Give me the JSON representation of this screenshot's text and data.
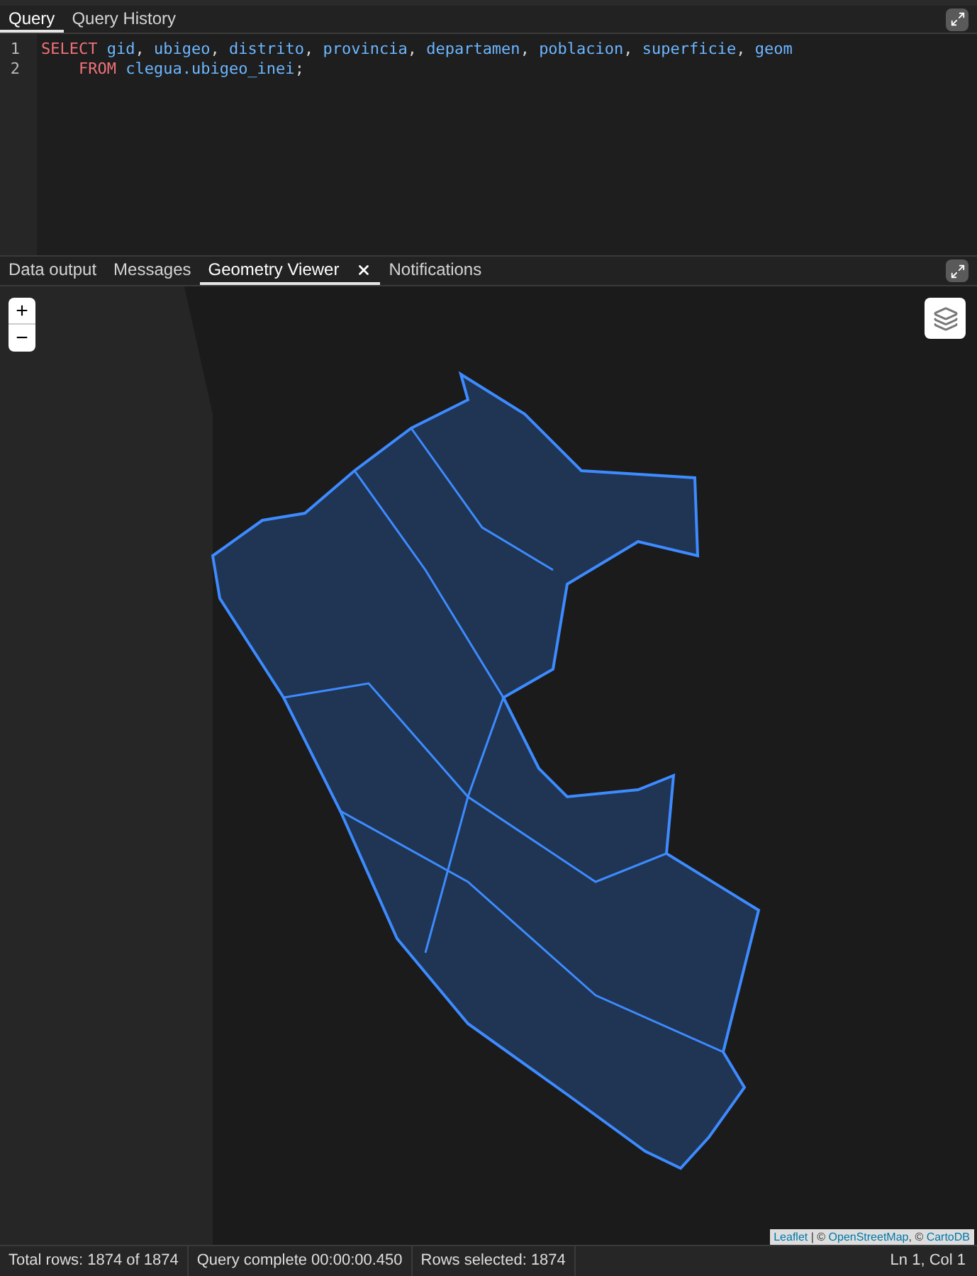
{
  "query_tabs": [
    {
      "label": "Query",
      "selected": true
    },
    {
      "label": "Query History",
      "selected": false
    }
  ],
  "editor": {
    "lines": [
      {
        "number": "1",
        "indent": false,
        "tokens": [
          {
            "text": "SELECT",
            "kind": "keyword"
          },
          {
            "text": "gid",
            "kind": "ident"
          },
          {
            "text": ", ",
            "kind": "punct"
          },
          {
            "text": "ubigeo",
            "kind": "ident"
          },
          {
            "text": ", ",
            "kind": "punct"
          },
          {
            "text": "distrito",
            "kind": "ident"
          },
          {
            "text": ", ",
            "kind": "punct"
          },
          {
            "text": "provincia",
            "kind": "ident"
          },
          {
            "text": ", ",
            "kind": "punct"
          },
          {
            "text": "departamen",
            "kind": "ident"
          },
          {
            "text": ", ",
            "kind": "punct"
          },
          {
            "text": "poblacion",
            "kind": "ident"
          },
          {
            "text": ", ",
            "kind": "punct"
          },
          {
            "text": "superficie",
            "kind": "ident"
          },
          {
            "text": ", ",
            "kind": "punct"
          },
          {
            "text": "geom",
            "kind": "ident"
          }
        ]
      },
      {
        "number": "2",
        "indent": true,
        "tokens": [
          {
            "text": "FROM",
            "kind": "keyword"
          },
          {
            "text": "clegua.ubigeo_inei",
            "kind": "ident"
          },
          {
            "text": ";",
            "kind": "punct"
          }
        ]
      }
    ]
  },
  "result_tabs": [
    {
      "label": "Data output",
      "selected": false,
      "closable": false
    },
    {
      "label": "Messages",
      "selected": false,
      "closable": false
    },
    {
      "label": "Geometry Viewer",
      "selected": true,
      "closable": true
    },
    {
      "label": "Notifications",
      "selected": false,
      "closable": false
    }
  ],
  "map": {
    "zoom_in": "+",
    "zoom_out": "−",
    "attribution": [
      {
        "text": "Leaflet",
        "kind": "link"
      },
      {
        "text": " | © ",
        "kind": "text"
      },
      {
        "text": "OpenStreetMap",
        "kind": "link"
      },
      {
        "text": ", © ",
        "kind": "text"
      },
      {
        "text": "CartoDB",
        "kind": "link"
      }
    ]
  },
  "status_bar": {
    "items": [
      "Total rows: 1874 of 1874",
      "Query complete 00:00:00.450",
      "Rows selected: 1874"
    ],
    "cursor": "Ln 1, Col 1"
  }
}
